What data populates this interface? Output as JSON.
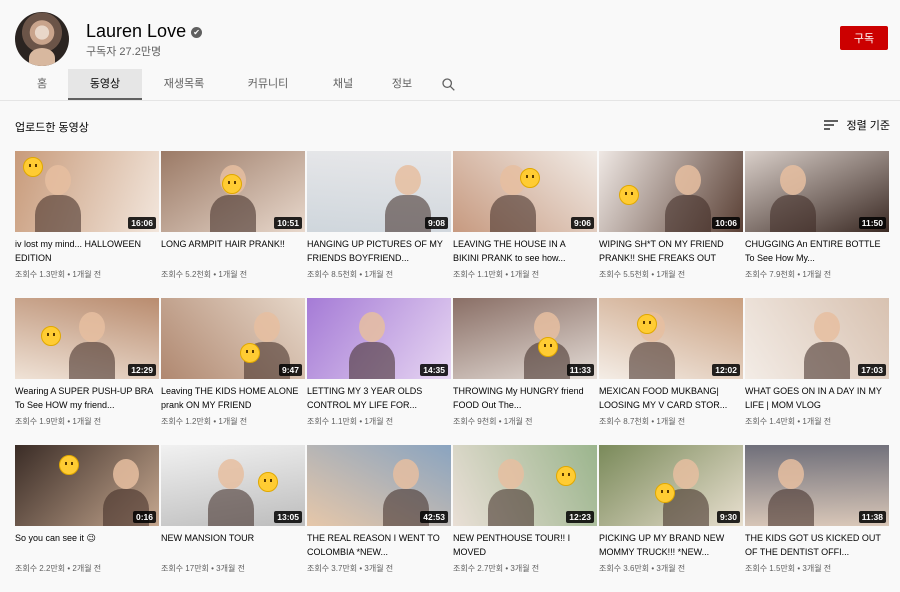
{
  "channel": {
    "name": "Lauren Love",
    "verified_glyph": "✔",
    "subscribers": "구독자 27.2만명",
    "subscribe_label": "구독"
  },
  "tabs": [
    {
      "label": "홈",
      "active": false
    },
    {
      "label": "동영상",
      "active": true
    },
    {
      "label": "재생목록",
      "active": false
    },
    {
      "label": "커뮤니티",
      "active": false
    },
    {
      "label": "채널",
      "active": false
    },
    {
      "label": "정보",
      "active": false
    }
  ],
  "icons": {
    "search": "search-icon",
    "sort": "sort-icon",
    "verified": "verified-icon"
  },
  "section": {
    "title": "업로드한 동영상",
    "sort_label": "정렬 기준"
  },
  "videos": [
    {
      "title": "iv lost my mind... HALLOWEEN EDITION",
      "duration": "16:06",
      "views": "조회수 1.3만회",
      "age": "1개월 전",
      "bg": [
        "#c89b7b",
        "#f2e6dc"
      ]
    },
    {
      "title": "LONG ARMPIT HAIR PRANK!!",
      "duration": "10:51",
      "views": "조회수 5.2천회",
      "age": "1개월 전",
      "bg": [
        "#9b7a66",
        "#e8d8cc"
      ]
    },
    {
      "title": "HANGING UP PICTURES OF MY FRIENDS BOYFRIEND...",
      "duration": "9:08",
      "views": "조회수 8.5천회",
      "age": "1개월 전",
      "bg": [
        "#e8e8ea",
        "#cfd6dc"
      ]
    },
    {
      "title": "LEAVING THE HOUSE IN A BIKINI PRANK to see how...",
      "duration": "9:06",
      "views": "조회수 1.1만회",
      "age": "1개월 전",
      "bg": [
        "#f1ebe6",
        "#c79a80"
      ]
    },
    {
      "title": "WIPING SH*T ON MY FRIEND PRANK!! SHE FREAKS OUT",
      "duration": "10:06",
      "views": "조회수 5.5천회",
      "age": "1개월 전",
      "bg": [
        "#efe8e4",
        "#5a4035"
      ]
    },
    {
      "title": "CHUGGING An ENTIRE BOTTLE To See How My...",
      "duration": "11:50",
      "views": "조회수 7.9천회",
      "age": "1개월 전",
      "bg": [
        "#d9cfc9",
        "#3b2a24"
      ]
    },
    {
      "title": "Wearing A SUPER PUSH-UP BRA To See HOW my friend...",
      "duration": "12:29",
      "views": "조회수 1.9만회",
      "age": "1개월 전",
      "bg": [
        "#b98c6f",
        "#efe2d6"
      ]
    },
    {
      "title": "Leaving THE KIDS HOME ALONE prank ON MY FRIEND",
      "duration": "9:47",
      "views": "조회수 1.2만회",
      "age": "1개월 전",
      "bg": [
        "#e6d7c9",
        "#b08870"
      ]
    },
    {
      "title": "LETTING MY 3 YEAR OLDS CONTROL MY LIFE FOR...",
      "duration": "14:35",
      "views": "조회수 1.1만회",
      "age": "1개월 전",
      "bg": [
        "#a57bd6",
        "#e7d6f2"
      ]
    },
    {
      "title": "THROWING My HUNGRY friend FOOD Out The...",
      "duration": "11:33",
      "views": "조회수 9천회",
      "age": "1개월 전",
      "bg": [
        "#8a6f66",
        "#e4dcd6"
      ]
    },
    {
      "title": "MEXICAN FOOD MUKBANG| LOOSING MY V CARD STOR...",
      "duration": "12:02",
      "views": "조회수 8.7천회",
      "age": "1개월 전",
      "bg": [
        "#c99f7f",
        "#f4ede6"
      ]
    },
    {
      "title": "WHAT GOES ON IN A DAY IN MY LIFE | MOM VLOG",
      "duration": "17:03",
      "views": "조회수 1.4만회",
      "age": "1개월 전",
      "bg": [
        "#d8c2b1",
        "#f3ece6"
      ]
    },
    {
      "title": "So you can see it 😉",
      "duration": "0:16",
      "views": "조회수 2.2만회",
      "age": "2개월 전",
      "bg": [
        "#3a2c26",
        "#c5a78f"
      ]
    },
    {
      "title": "NEW MANSION TOUR",
      "duration": "13:05",
      "views": "조회수 17만회",
      "age": "3개월 전",
      "bg": [
        "#f1f1f1",
        "#bdbdbd"
      ]
    },
    {
      "title": "THE REAL REASON I WENT TO COLOMBIA *NEW...",
      "duration": "42:53",
      "views": "조회수 3.7만회",
      "age": "3개월 전",
      "bg": [
        "#8aa4c0",
        "#e6c7a9"
      ]
    },
    {
      "title": "NEW PENTHOUSE TOUR!! I MOVED",
      "duration": "12:23",
      "views": "조회수 2.7만회",
      "age": "3개월 전",
      "bg": [
        "#9bb58d",
        "#e9dfd6"
      ]
    },
    {
      "title": "PICKING UP MY BRAND NEW MOMMY TRUCK!!! *NEW...",
      "duration": "9:30",
      "views": "조회수 3.6만회",
      "age": "3개월 전",
      "bg": [
        "#7a8a5a",
        "#e8dfcf"
      ]
    },
    {
      "title": "THE KIDS GOT US KICKED OUT OF THE DENTIST OFFI...",
      "duration": "11:38",
      "views": "조회수 1.5만회",
      "age": "3개월 전",
      "bg": [
        "#6f6f7a",
        "#d9c7b8"
      ]
    }
  ],
  "colors": {
    "accent": "#cc0000",
    "text": "#030303",
    "muted": "#606060",
    "bg": "#f9f9f9"
  }
}
